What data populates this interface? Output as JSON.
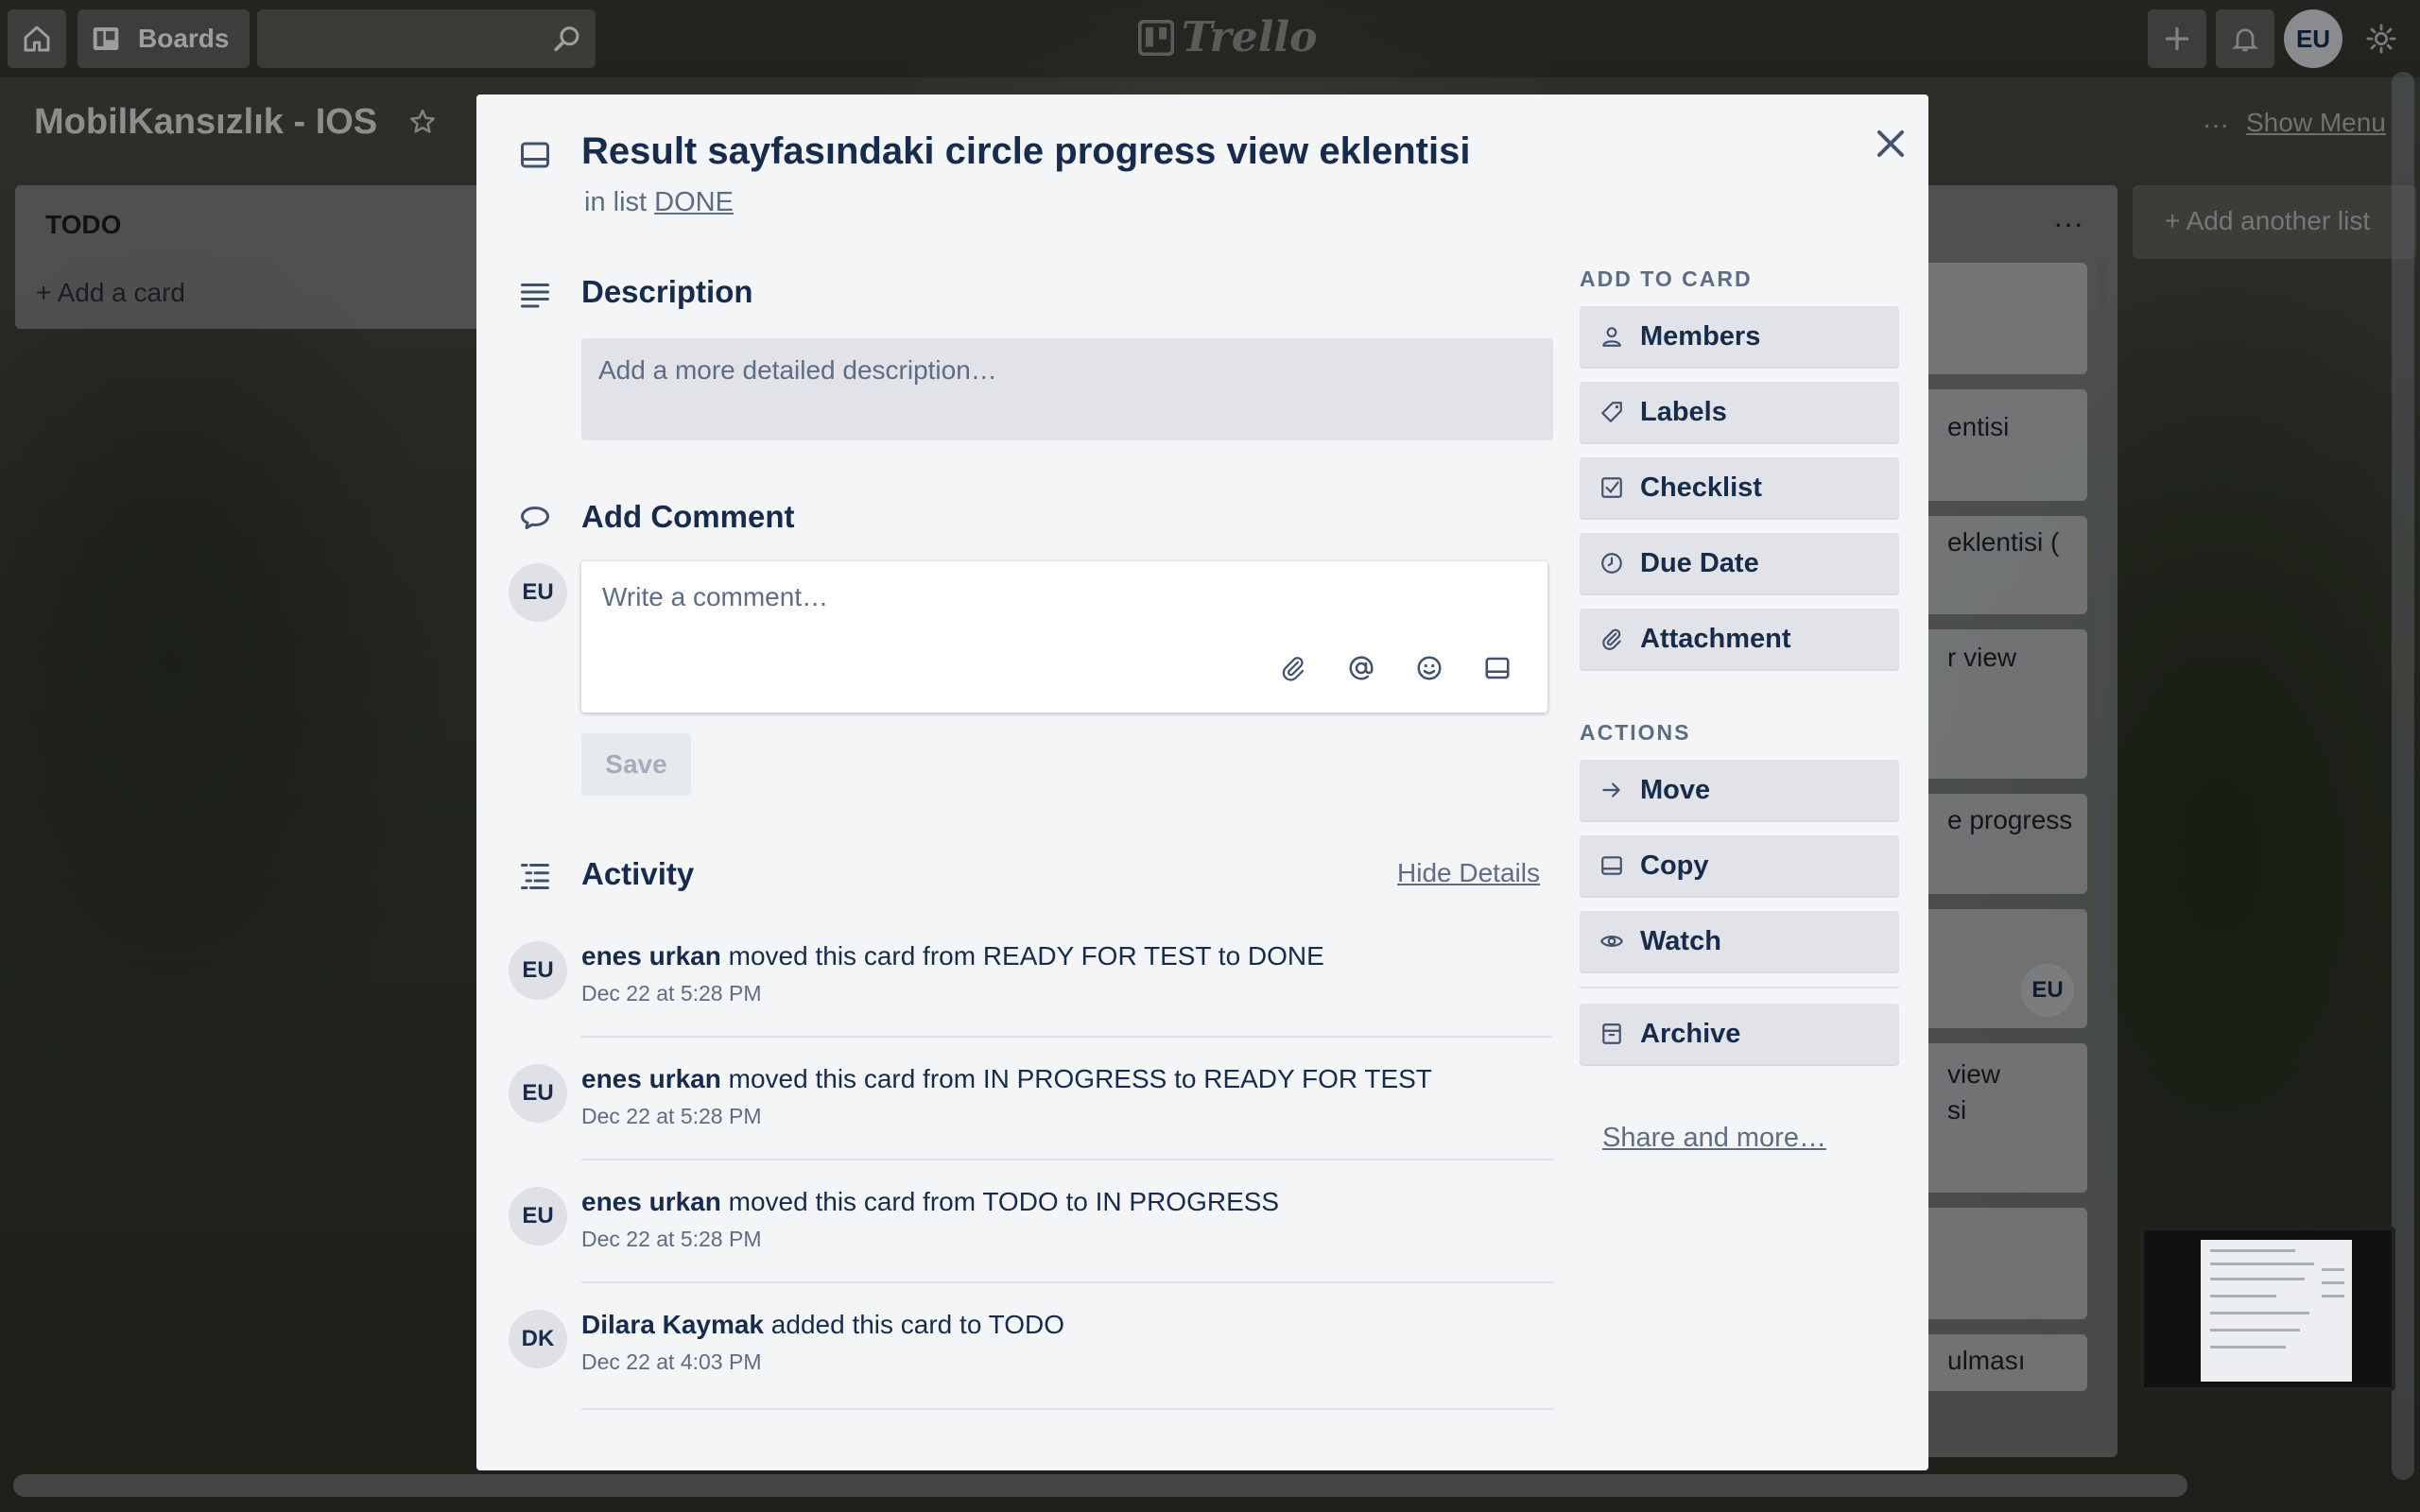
{
  "header": {
    "boards_label": "Boards",
    "logo_text": "Trello",
    "user_initials": "EU"
  },
  "board": {
    "title": "MobilKansızlık - IOS",
    "show_menu_label": "Show Menu",
    "add_list_label": "+ Add another list"
  },
  "lists": {
    "todo": {
      "title": "TODO",
      "add_card_label": "+ Add a card"
    },
    "done": {
      "cards": [
        {
          "text": ""
        },
        {
          "text": "entisi"
        },
        {
          "text": "eklentisi ("
        },
        {
          "text": "r view"
        },
        {
          "text": "e progress"
        },
        {
          "text": "",
          "avatar": "EU"
        },
        {
          "text": "view\nsi"
        },
        {
          "text": ""
        },
        {
          "text": "ulması"
        }
      ]
    }
  },
  "modal": {
    "title": "Result sayfasındaki circle progress view eklentisi",
    "in_list_prefix": "in list",
    "list_name": "DONE",
    "description": {
      "heading": "Description",
      "placeholder": "Add a more detailed description…"
    },
    "comment": {
      "heading": "Add Comment",
      "avatar": "EU",
      "placeholder": "Write a comment…",
      "save_label": "Save"
    },
    "activity": {
      "heading": "Activity",
      "hide_details_label": "Hide Details",
      "items": [
        {
          "avatar": "EU",
          "user": "enes urkan",
          "action": "moved this card from READY FOR TEST to DONE",
          "time": "Dec 22 at 5:28 PM"
        },
        {
          "avatar": "EU",
          "user": "enes urkan",
          "action": "moved this card from IN PROGRESS to READY FOR TEST",
          "time": "Dec 22 at 5:28 PM"
        },
        {
          "avatar": "EU",
          "user": "enes urkan",
          "action": "moved this card from TODO to IN PROGRESS",
          "time": "Dec 22 at 5:28 PM"
        },
        {
          "avatar": "DK",
          "user": "Dilara Kaymak",
          "action": "added this card to TODO",
          "time": "Dec 22 at 4:03 PM"
        }
      ]
    },
    "sidebar": {
      "add_to_card_heading": "ADD TO CARD",
      "add_to_card": [
        "Members",
        "Labels",
        "Checklist",
        "Due Date",
        "Attachment"
      ],
      "actions_heading": "ACTIONS",
      "actions": [
        "Move",
        "Copy",
        "Watch"
      ],
      "archive_label": "Archive",
      "share_label": "Share and more…"
    }
  },
  "colors": {
    "modal_bg": "#f4f5f7",
    "text_primary": "#172b4d",
    "text_muted": "#5e6c84"
  }
}
